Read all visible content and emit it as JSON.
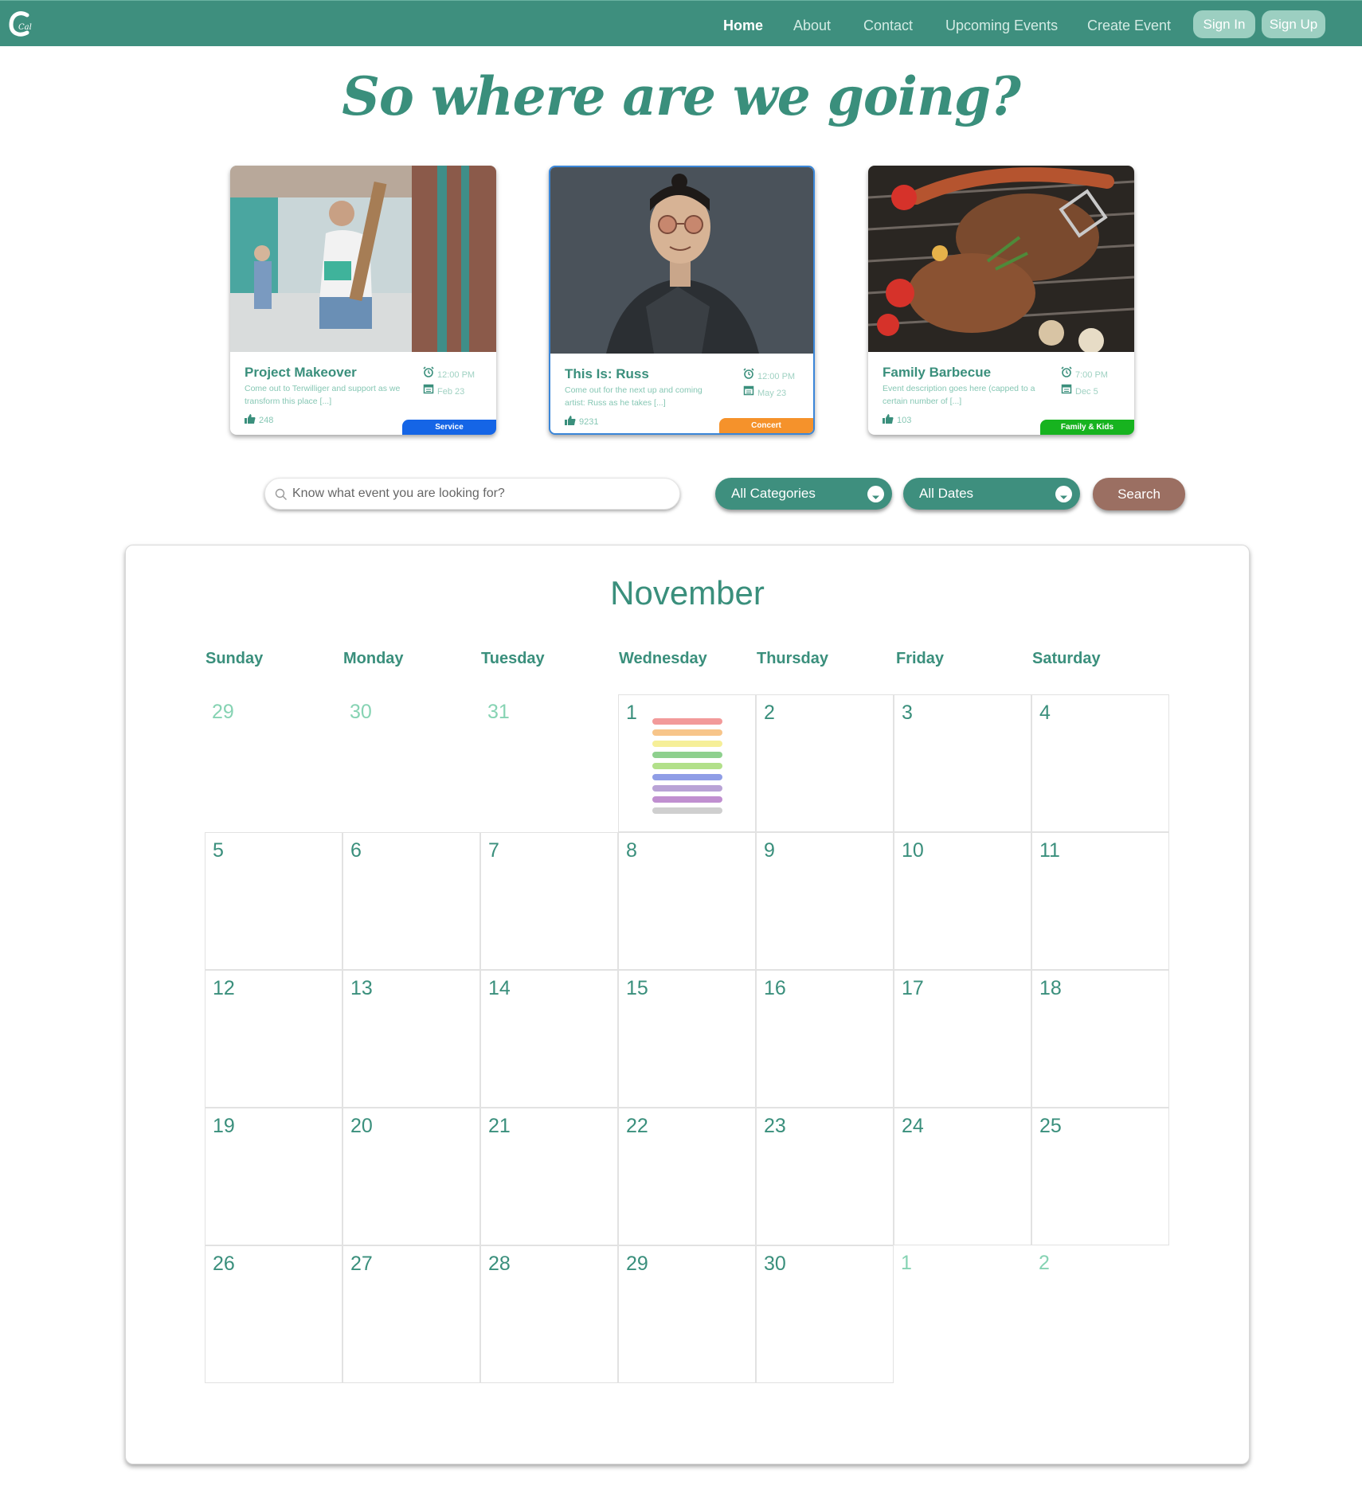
{
  "nav": {
    "logo_icon": "cal-logo-icon",
    "links": [
      {
        "label": "Home",
        "active": true
      },
      {
        "label": "About",
        "active": false
      },
      {
        "label": "Contact",
        "active": false
      },
      {
        "label": "Upcoming Events",
        "active": false
      },
      {
        "label": "Create Event",
        "active": false
      }
    ],
    "sign_in": "Sign In",
    "sign_up": "Sign Up"
  },
  "hero": {
    "title": "So where are we going?"
  },
  "featured": [
    {
      "title": "Project Makeover",
      "description": "Come out to Terwilliger and support as we transform this place [...]",
      "time": "12:00 PM",
      "date": "Feb 23",
      "likes": "248",
      "category": "Service",
      "category_color": "#1565e6"
    },
    {
      "title": "This Is: Russ",
      "description": "Come out for the next up and coming artist: Russ as he takes [...]",
      "time": "12:00 PM",
      "date": "May 23",
      "likes": "9231",
      "category": "Concert",
      "category_color": "#f5922b"
    },
    {
      "title": "Family Barbecue",
      "description": "Event description goes here (capped to a certain number of [...]",
      "time": "7:00 PM",
      "date": "Dec 5",
      "likes": "103",
      "category": "Family & Kids",
      "category_color": "#17b31f"
    }
  ],
  "search": {
    "placeholder": "Know what event you are looking for?",
    "category_selected": "All Categories",
    "date_selected": "All Dates",
    "button": "Search"
  },
  "calendar": {
    "month": "November",
    "weekdays": [
      "Sunday",
      "Monday",
      "Tuesday",
      "Wednesday",
      "Thursday",
      "Friday",
      "Saturday"
    ],
    "weeks": [
      [
        "29",
        "30",
        "31",
        "1",
        "2",
        "3",
        "4"
      ],
      [
        "5",
        "6",
        "7",
        "8",
        "9",
        "10",
        "11"
      ],
      [
        "12",
        "13",
        "14",
        "15",
        "16",
        "17",
        "18"
      ],
      [
        "19",
        "20",
        "21",
        "22",
        "23",
        "24",
        "25"
      ],
      [
        "26",
        "27",
        "28",
        "29",
        "30",
        "1",
        "2"
      ]
    ],
    "event_bar_colors": [
      "#f29a9a",
      "#f7c58a",
      "#f6ef98",
      "#8ed08e",
      "#b2e08a",
      "#8f9de6",
      "#b9a3d6",
      "#c08fd0",
      "#cfcfcf"
    ]
  },
  "colors": {
    "primary": "#3e8f7e",
    "accent": "#9b6f62",
    "nav_button": "#9ccfc1"
  }
}
